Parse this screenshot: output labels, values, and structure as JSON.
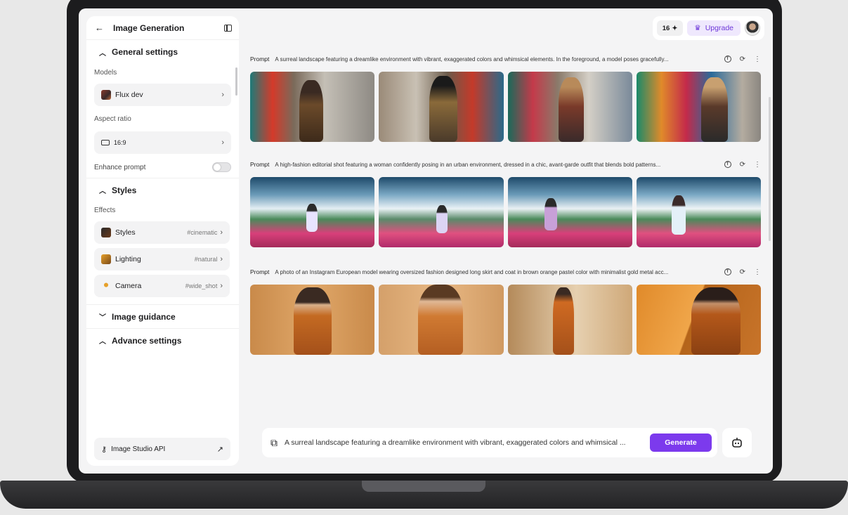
{
  "sidebar": {
    "title": "Image Generation",
    "general_settings": "General settings",
    "models_label": "Models",
    "model_value": "Flux dev",
    "aspect_label": "Aspect ratio",
    "aspect_value": "16:9",
    "enhance_label": "Enhance prompt",
    "enhance_on": false,
    "styles_section": "Styles",
    "effects_label": "Effects",
    "effects": [
      {
        "label": "Styles",
        "tag": "#cinematic"
      },
      {
        "label": "Lighting",
        "tag": "#natural"
      },
      {
        "label": "Camera",
        "tag": "#wide_shot"
      }
    ],
    "image_guidance": "Image guidance",
    "advance_settings": "Advance settings",
    "api_label": "Image Studio API"
  },
  "topbar": {
    "credits": "16",
    "upgrade_label": "Upgrade"
  },
  "groups": [
    {
      "label": "Prompt",
      "text": "A surreal landscape featuring a dreamlike environment with vibrant, exaggerated colors and whimsical elements. In the foreground, a model poses gracefully..."
    },
    {
      "label": "Prompt",
      "text": "A high-fashion editorial shot featuring a woman confidently posing in an urban environment, dressed in a chic, avant-garde outfit that blends bold patterns..."
    },
    {
      "label": "Prompt",
      "text": "A photo of an Instagram European model wearing oversized fashion designed long skirt and coat in brown orange pastel color with minimalist gold metal acc..."
    }
  ],
  "generate": {
    "prompt": "A surreal landscape featuring a dreamlike environment with vibrant, exaggerated colors and whimsical ...",
    "button_label": "Generate"
  },
  "colors": {
    "accent": "#7c3aed",
    "upgrade_text": "#6d36d9"
  }
}
